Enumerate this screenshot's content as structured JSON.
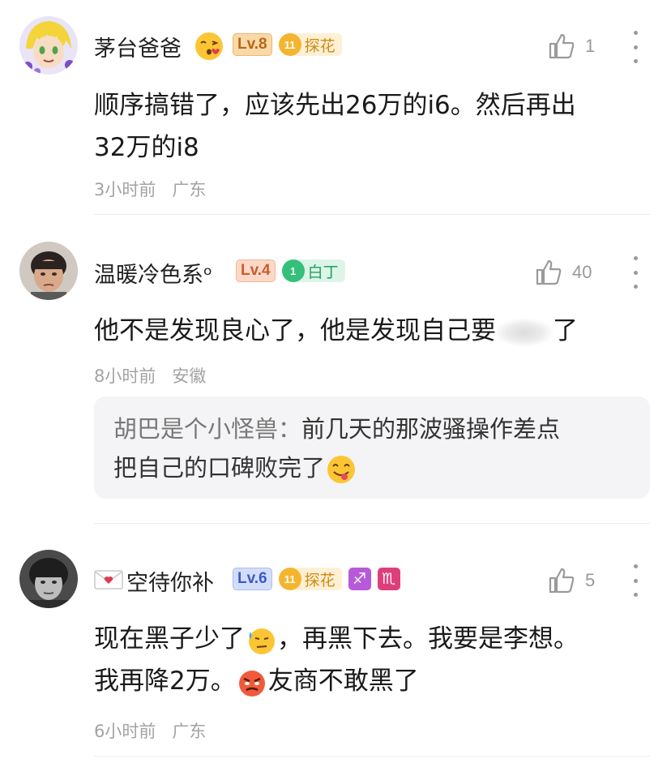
{
  "comments": [
    {
      "username": "茅台爸爸",
      "level": "Lv.8",
      "fan_level": "11",
      "fan_label": "探花",
      "likes": "1",
      "text_a": "顺序搞错了，应该先出26万的i6。然后再出",
      "text_b": "32万的i8",
      "time": "3小时前",
      "location": "广东"
    },
    {
      "username": "温暖冷色系ᵒ",
      "level": "Lv.4",
      "fan_level": "1",
      "fan_label": "白丁",
      "likes": "40",
      "text_a": "他不是发现良心了，他是发现自己要",
      "text_tail": "了",
      "time": "8小时前",
      "location": "安徽",
      "reply": {
        "author": "胡巴是个小怪兽：",
        "text_a": "前几天的那波骚操作差点",
        "text_b": "把自己的口碑败完了"
      }
    },
    {
      "username": "空待你补",
      "level": "Lv.6",
      "fan_level": "11",
      "fan_label": "探花",
      "zodiac_1": "♐",
      "zodiac_2": "♏",
      "likes": "5",
      "text_a_1": "现在黑子少了",
      "text_a_2": "，再黑下去。我要是李想。",
      "text_b_1": "我再降2万。",
      "text_b_2": "友商不敢黑了",
      "time": "6小时前",
      "location": "广东"
    }
  ]
}
